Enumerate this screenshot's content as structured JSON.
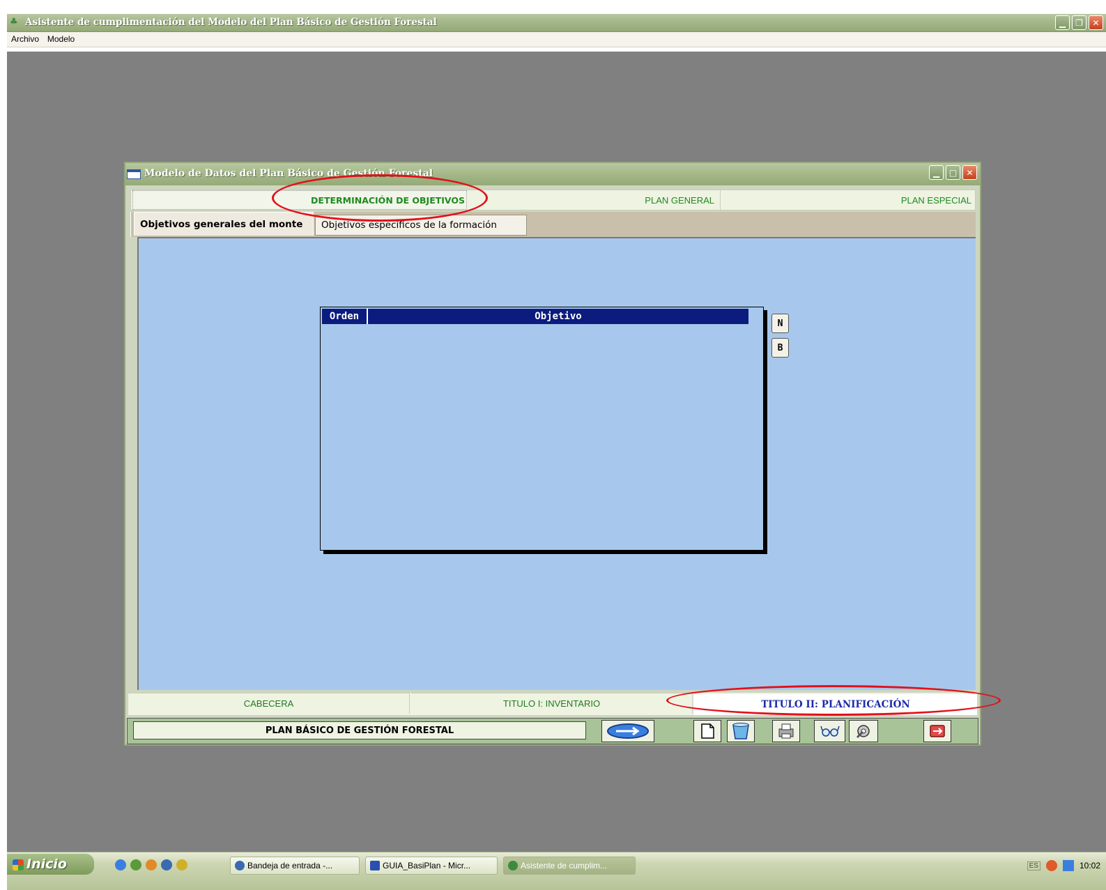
{
  "app": {
    "title": "Asistente de cumplimentación del Modelo del Plan Básico de Gestión Forestal",
    "menu": [
      "Archivo",
      "Modelo"
    ]
  },
  "inner_window": {
    "title": "Modelo de Datos del Plan Básico de Gestión Forestal",
    "top_tabs": [
      "DETERMINACIÓN DE OBJETIVOS",
      "PLAN GENERAL",
      "PLAN ESPECIAL"
    ],
    "sub_tabs": [
      "Objetivos generales del monte",
      "Objetivos específicos de la formación"
    ],
    "grid": {
      "columns": [
        "Orden",
        "Objetivo"
      ],
      "rows": []
    },
    "side_buttons": [
      "N",
      "B"
    ],
    "bottom_tabs": [
      "CABECERA",
      "TITULO I: INVENTARIO",
      "TITULO II: PLANIFICACIÓN"
    ],
    "plan_label": "PLAN BÁSICO DE GESTIÓN FORESTAL",
    "toolbar_icons": [
      "arrow-next-icon",
      "new-page-icon",
      "trash-icon",
      "print-icon",
      "glasses-icon",
      "tools-icon",
      "exit-icon"
    ]
  },
  "taskbar": {
    "start_label": "Inicio",
    "items": [
      "Bandeja de entrada -...",
      "GUIA_BasiPlan - Micr...",
      "Asistente de cumplim..."
    ],
    "lang": "ES",
    "clock": "10:02"
  },
  "colors": {
    "accent_green": "#1f8a1f",
    "grid_header": "#0b1c7e",
    "content_bg": "#a7c8ec",
    "highlight_ellipse": "#e2101a"
  }
}
